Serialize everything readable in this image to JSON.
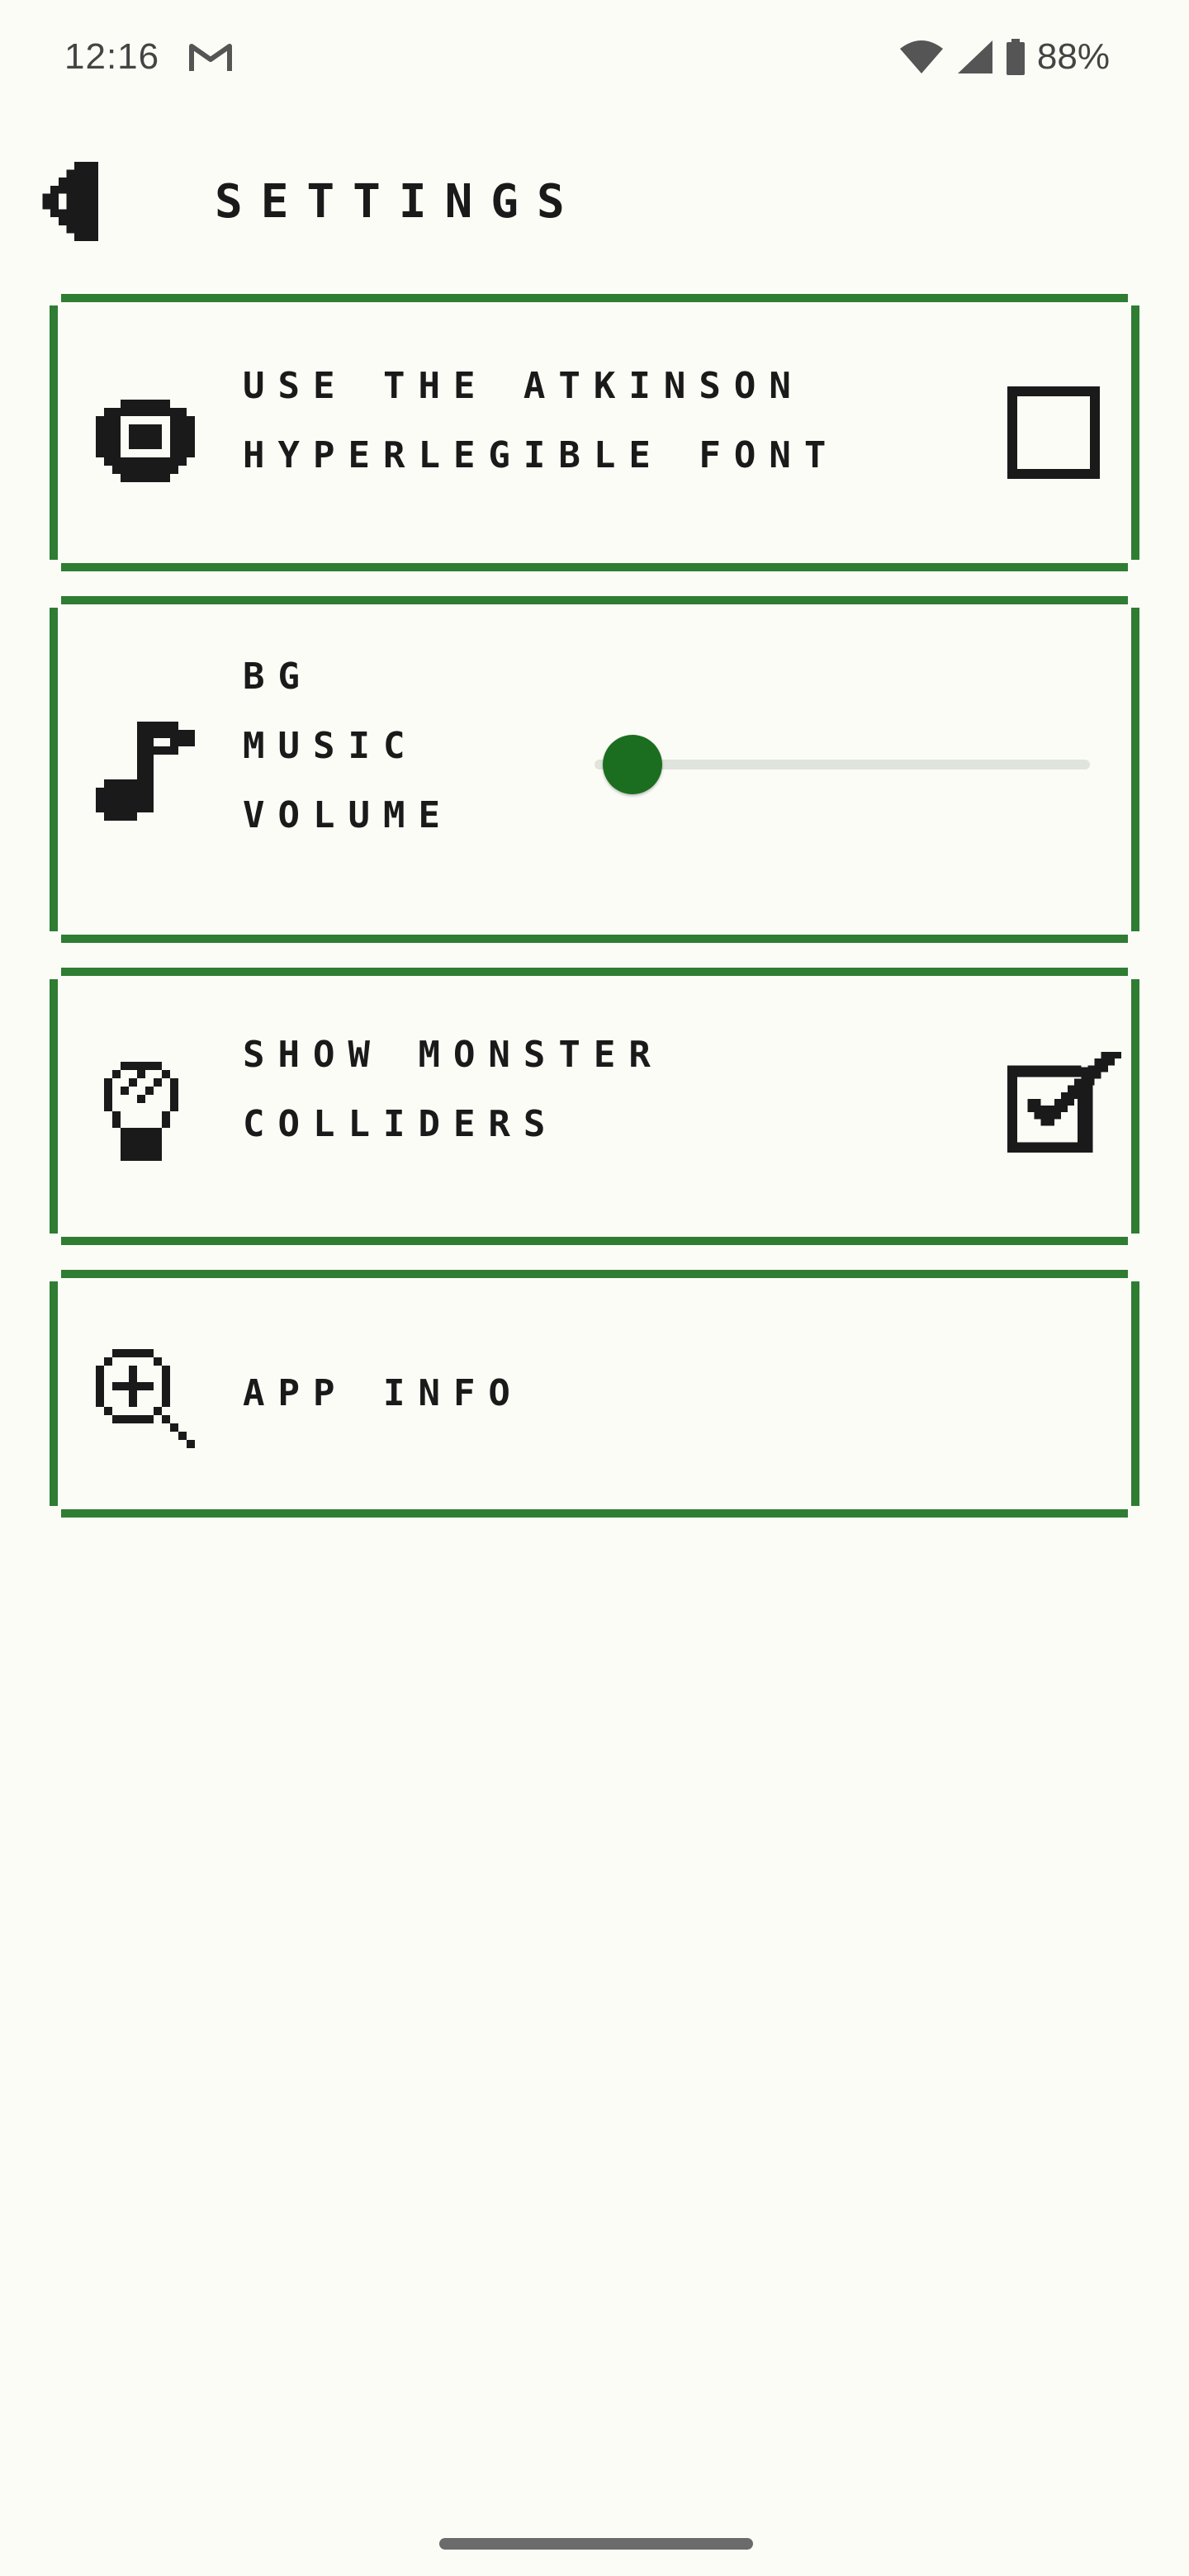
{
  "status_bar": {
    "time": "12:16",
    "battery": "88%",
    "icons": [
      "gmail-icon",
      "wifi-icon",
      "signal-icon",
      "battery-icon"
    ]
  },
  "header": {
    "title": "SETTINGS",
    "back_icon": "back-arrow-icon"
  },
  "settings": {
    "font_option": {
      "label": "USE THE ATKINSON\nHYPERLEGIBLE FONT",
      "icon": "eye-icon",
      "checked": false
    },
    "music_volume": {
      "label": "BG\nMUSIC\nVOLUME",
      "icon": "music-note-icon",
      "value": 0
    },
    "colliders_option": {
      "label": "SHOW MONSTER\nCOLLIDERS",
      "icon": "lightbulb-icon",
      "checked": true
    },
    "app_info": {
      "label": "APP INFO",
      "icon": "zoom-in-icon"
    }
  },
  "colors": {
    "accent": "#2e7d32",
    "slider_thumb": "#1b6e1f",
    "background": "#fcfcf7",
    "ink": "#1a1a1a"
  }
}
